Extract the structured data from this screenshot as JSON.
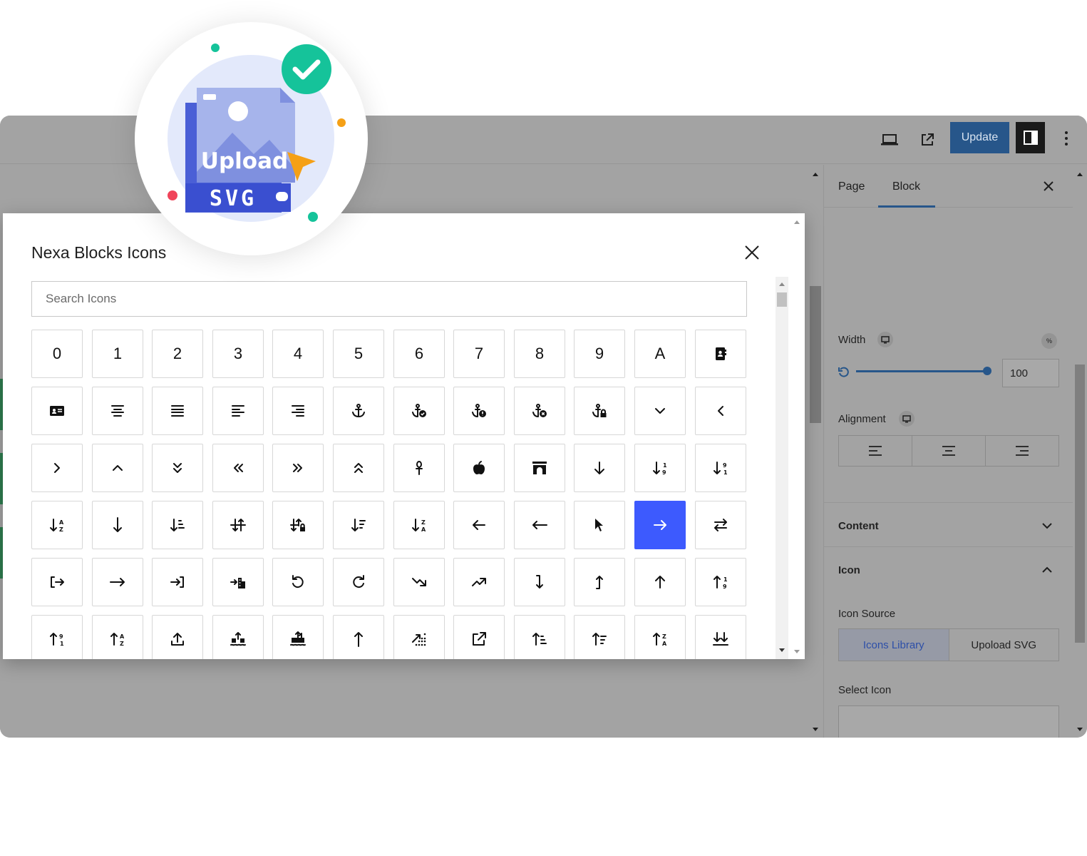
{
  "toolbar": {
    "update_label": "Update"
  },
  "modal": {
    "title": "Nexa Blocks Icons",
    "search_placeholder": "Search Icons",
    "text_icons": [
      "0",
      "1",
      "2",
      "3",
      "4",
      "5",
      "6",
      "7",
      "8",
      "9",
      "A"
    ],
    "icon_names": [
      "digit-0",
      "digit-1",
      "digit-2",
      "digit-3",
      "digit-4",
      "digit-5",
      "digit-6",
      "digit-7",
      "digit-8",
      "digit-9",
      "letter-a",
      "address-book-icon",
      "address-card-icon",
      "align-center-icon",
      "align-justify-icon",
      "align-left-icon",
      "align-right-icon",
      "anchor-icon",
      "anchor-circle-check-icon",
      "anchor-circle-exclamation-icon",
      "anchor-circle-xmark-icon",
      "anchor-lock-icon",
      "angle-down-icon",
      "angle-left-icon",
      "angle-right-icon",
      "angle-up-icon",
      "angles-down-icon",
      "angles-left-icon",
      "angles-right-icon",
      "angles-up-icon",
      "ankh-icon",
      "apple-whole-icon",
      "archway-icon",
      "arrow-down-icon",
      "arrow-down-1-9-icon",
      "arrow-down-9-1-icon",
      "arrow-down-a-z-icon",
      "arrow-down-long-icon",
      "arrow-down-short-wide-icon",
      "arrow-down-up-across-line-icon",
      "arrow-down-up-lock-icon",
      "arrow-down-wide-short-icon",
      "arrow-down-z-a-icon",
      "arrow-left-icon",
      "arrow-left-long-icon",
      "arrow-pointer-icon",
      "arrow-right-icon",
      "arrow-right-arrow-left-icon",
      "arrow-right-from-bracket-icon",
      "arrow-right-long-icon",
      "arrow-right-to-bracket-icon",
      "arrow-right-to-city-icon",
      "arrow-rotate-left-icon",
      "arrow-rotate-right-icon",
      "arrow-trend-down-icon",
      "arrow-trend-up-icon",
      "arrow-turn-down-icon",
      "arrow-turn-up-icon",
      "arrow-up-icon",
      "arrow-up-1-9-icon",
      "arrow-up-9-1-icon",
      "arrow-up-a-z-icon",
      "arrow-up-from-bracket-icon",
      "arrow-up-from-ground-water-icon",
      "arrow-up-from-water-pump-icon",
      "arrow-up-long-icon",
      "arrow-up-right-dots-icon",
      "arrow-up-right-from-square-icon",
      "arrow-up-short-wide-icon",
      "arrow-up-wide-short-icon",
      "arrow-up-z-a-icon",
      "arrows-down-to-line-icon"
    ],
    "selected_icon": "arrow-right-icon"
  },
  "sidebar": {
    "tabs": [
      "Page",
      "Block"
    ],
    "width_label": "Width",
    "width_unit": "%",
    "width_value": "100",
    "alignment_label": "Alignment",
    "content_label": "Content",
    "icon_label": "Icon",
    "icon_source_label": "Icon Source",
    "icon_source_options": [
      "Icons Library",
      "Upoload SVG"
    ],
    "select_icon_label": "Select Icon"
  },
  "badge": {
    "upload_text": "Upload",
    "svg_text": "SVG"
  },
  "colors": {
    "accent": "#3d5afe",
    "update_button": "#27568a",
    "badge_check": "#15c39a",
    "badge_file": "#4a5fd6",
    "badge_cursor": "#f5a016"
  }
}
